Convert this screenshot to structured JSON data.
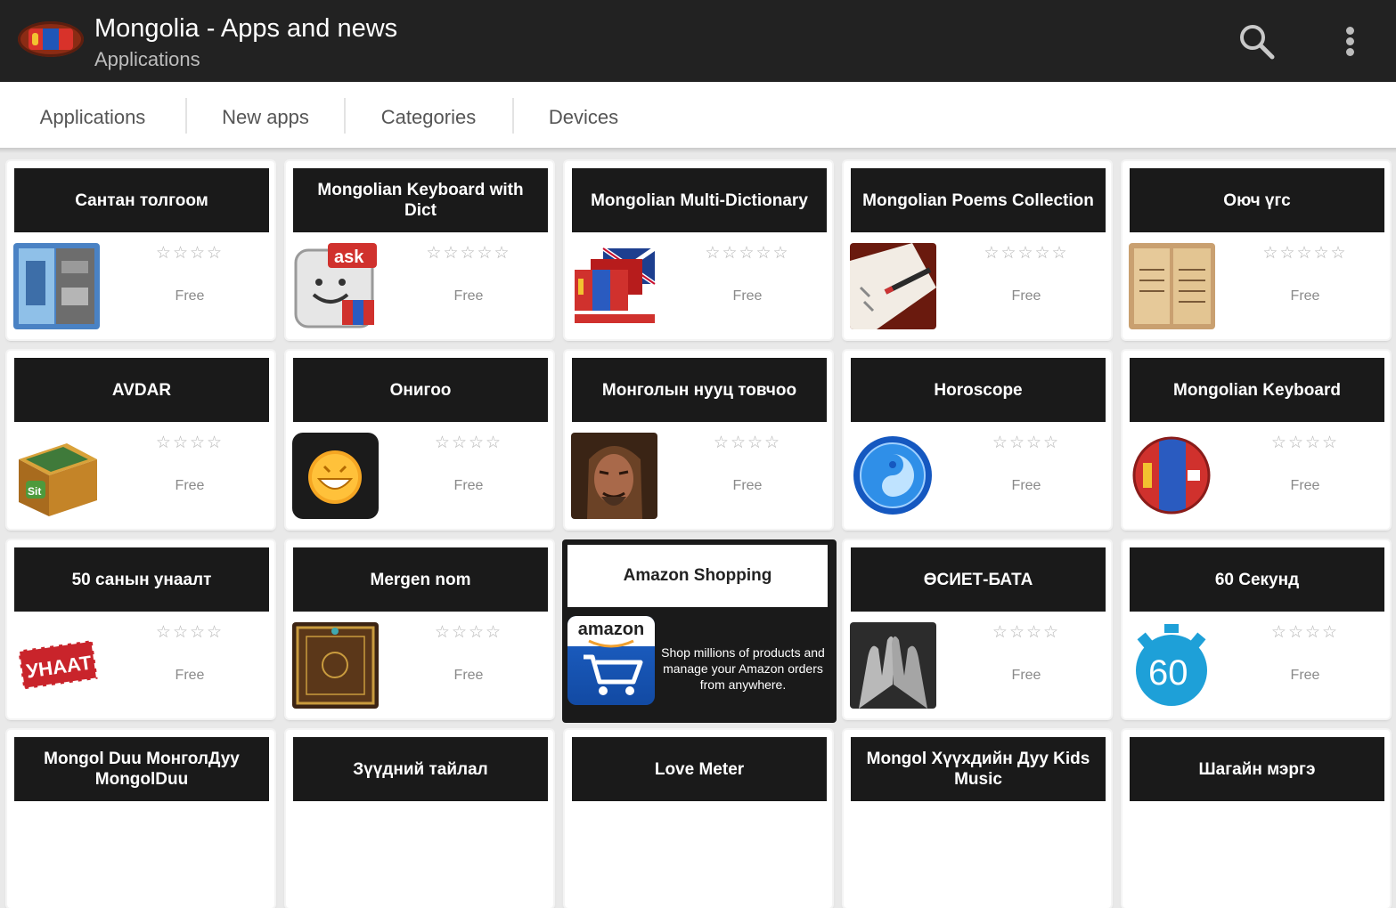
{
  "app": {
    "title": "Mongolia - Apps and news",
    "subtitle": "Applications",
    "icons": [
      "mongolia-flag-logo",
      "search-icon",
      "overflow-menu-icon"
    ]
  },
  "tabs": [
    {
      "label": "Applications"
    },
    {
      "label": "New apps"
    },
    {
      "label": "Categories"
    },
    {
      "label": "Devices"
    }
  ],
  "apps": [
    {
      "title": "Сантан толгоом",
      "stars": "☆☆☆☆",
      "price": "Free",
      "icon": "puzzle-app-icon"
    },
    {
      "title": "Mongolian Keyboard with Dict",
      "stars": "☆☆☆☆☆",
      "price": "Free",
      "icon": "keyboard-ask-icon"
    },
    {
      "title": "Mongolian Multi-Dictionary",
      "stars": "☆☆☆☆☆",
      "price": "Free",
      "icon": "flags-dictionary-icon"
    },
    {
      "title": "Mongolian Poems Collection",
      "stars": "☆☆☆☆☆",
      "price": "Free",
      "icon": "notebook-pen-icon"
    },
    {
      "title": "Оюч үгс",
      "stars": "☆☆☆☆☆",
      "price": "Free",
      "icon": "old-manuscript-icon"
    },
    {
      "title": "AVDAR",
      "stars": "☆☆☆☆",
      "price": "Free",
      "icon": "treasure-box-icon"
    },
    {
      "title": "Онигоо",
      "stars": "☆☆☆☆",
      "price": "Free",
      "icon": "smiley-face-icon"
    },
    {
      "title": "Монголын нууц товчоо",
      "stars": "☆☆☆☆",
      "price": "Free",
      "icon": "chinggis-portrait-icon"
    },
    {
      "title": "Horoscope",
      "stars": "☆☆☆☆",
      "price": "Free",
      "icon": "yin-yang-zodiac-icon"
    },
    {
      "title": "Mongolian Keyboard",
      "stars": "☆☆☆☆",
      "price": "Free",
      "icon": "flag-circle-icon"
    },
    {
      "title": "50 санын унаалт",
      "stars": "☆☆☆☆",
      "price": "Free",
      "icon": "unaat-ticket-icon"
    },
    {
      "title": "Mergen nom",
      "stars": "☆☆☆☆",
      "price": "Free",
      "icon": "ornate-book-icon"
    },
    {
      "title": "ӨСИЕТ-БАТА",
      "stars": "☆☆☆☆",
      "price": "Free",
      "icon": "praying-hands-icon"
    },
    {
      "title": "60 Секунд",
      "stars": "☆☆☆☆",
      "price": "Free",
      "icon": "stopwatch-60-icon"
    },
    {
      "title": "Mongol Duu МонголДуу MongolDuu"
    },
    {
      "title": "Зүүдний тайлал"
    },
    {
      "title": "Love Meter"
    },
    {
      "title": "Mongol Хүүхдийн Дуу Kids Music"
    },
    {
      "title": "Шагайн мэргэ"
    }
  ],
  "ad": {
    "title": "Amazon Shopping",
    "logo_text": "amazon",
    "description": "Shop millions of products and manage your Amazon orders from anywhere.",
    "icon": "amazon-cart-icon"
  },
  "colors": {
    "appbar": "#222222",
    "card_header": "#1a1a1a",
    "background": "#e9e9e9",
    "amazon_blue": "#1e62c8"
  }
}
